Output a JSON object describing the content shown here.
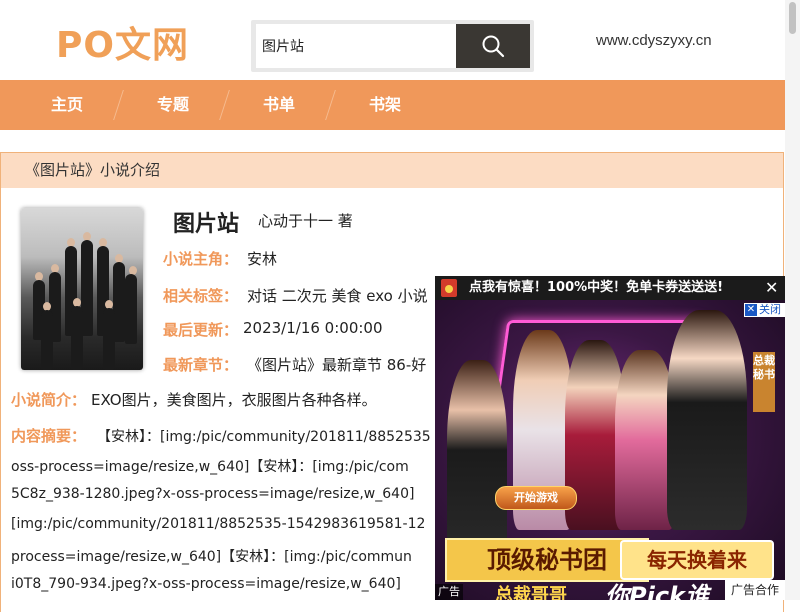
{
  "header": {
    "logo": "PO文网",
    "search_value": "图片站",
    "site_url": "www.cdyszyxy.cn"
  },
  "nav": {
    "items": [
      "主页",
      "专题",
      "书单",
      "书架"
    ]
  },
  "book": {
    "section_title": "《图片站》小说介绍",
    "title": "图片站",
    "author": "心动于十一 著",
    "labels": {
      "protagonist": "小说主角：",
      "tags": "相关标签：",
      "updated": "最后更新：",
      "latest": "最新章节：",
      "intro": "小说简介：",
      "content": "内容摘要："
    },
    "protagonist": "安林",
    "tags": "对话 二次元 美食 exo 小说",
    "updated": "2023/1/16 0:00:00",
    "latest": "《图片站》最新章节 86-好",
    "intro": "EXO图片，美食图片，衣服图片各种各样。",
    "content_lines": [
      "【安林】：[img:/pic/community/201811/8852535",
      "oss-process=image/resize,w_640]【安林】：[img:/pic/com",
      "5C8z_938-1280.jpeg?x-oss-process=image/resize,w_640]",
      "[img:/pic/community/201811/8852535-1542983619581-12",
      "process=image/resize,w_640]【安林】：[img:/pic/commun",
      "i0T8_790-934.jpeg?x-oss-process=image/resize,w_640]"
    ]
  },
  "ad": {
    "bar_text": "点我有惊喜！100%中奖！免单卡券送送送!",
    "bar_close": "✕",
    "close_x": "✕",
    "close_label": "关闭",
    "side_tag": "总裁秘书",
    "game_button": "开始游戏",
    "banner_main": "顶级秘书团",
    "banner_right": "每天换着来",
    "banner_sub": "总裁哥哥",
    "banner_pick": "你Pick谁",
    "footer_left": "广告",
    "footer_right": "广告合作"
  }
}
